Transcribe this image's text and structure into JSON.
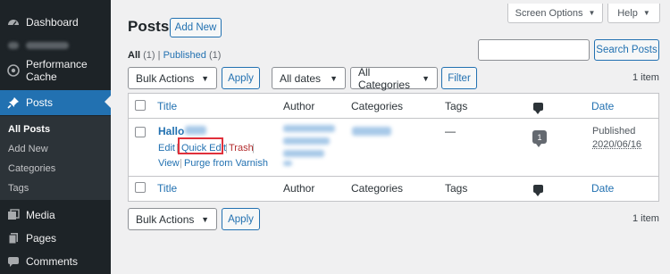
{
  "sidebar": {
    "items": [
      {
        "label": "Dashboard",
        "icon": "dashboard-icon"
      },
      {
        "label": "",
        "icon": "blurred-plugin-icon"
      },
      {
        "label": "Performance Cache",
        "icon": "performance-cache-icon"
      },
      {
        "label": "Posts",
        "icon": "pin-icon"
      },
      {
        "label": "Media",
        "icon": "media-icon"
      },
      {
        "label": "Pages",
        "icon": "pages-icon"
      },
      {
        "label": "Comments",
        "icon": "comments-icon"
      }
    ],
    "submenu": [
      "All Posts",
      "Add New",
      "Categories",
      "Tags"
    ]
  },
  "header": {
    "title": "Posts",
    "add_new": "Add New",
    "screen_options": "Screen Options",
    "help": "Help"
  },
  "filters": {
    "all_label": "All",
    "all_count": "(1)",
    "separator": "|",
    "published_label": "Published",
    "published_count": "(1)",
    "search_placeholder": "",
    "search_button": "Search Posts",
    "bulk_actions": "Bulk Actions",
    "apply": "Apply",
    "all_dates": "All dates",
    "all_categories": "All Categories",
    "filter": "Filter",
    "item_count": "1 item"
  },
  "table": {
    "columns": {
      "title": "Title",
      "author": "Author",
      "categories": "Categories",
      "tags": "Tags",
      "date": "Date"
    },
    "row": {
      "title": "Hallo",
      "actions": {
        "edit": "Edit",
        "quick_edit": "Quick Edit",
        "trash": "Trash",
        "view": "View",
        "purge": "Purge from Varnish"
      },
      "tags": "—",
      "comments": "1",
      "status": "Published",
      "date": "2020/06/16"
    }
  },
  "colors": {
    "accent": "#2271b1",
    "sidebar_bg": "#1d2327",
    "highlight": "#e0303b",
    "trash": "#b32d2e"
  }
}
